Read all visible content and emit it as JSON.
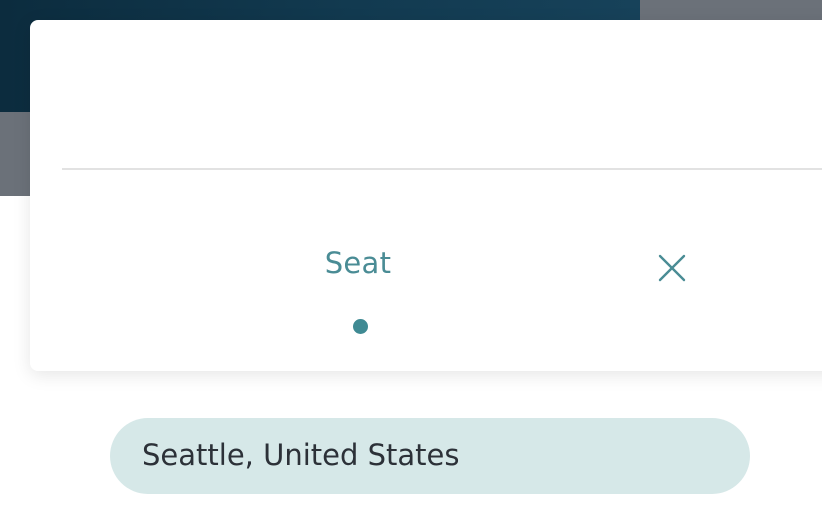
{
  "search": {
    "value": "",
    "placeholder": ""
  },
  "tabs": [
    {
      "label": "Seat",
      "active": true
    }
  ],
  "close": {
    "icon": "close-icon"
  },
  "location": {
    "label": "Seattle, United States"
  },
  "colors": {
    "accent": "#3f8a93",
    "tab_text": "#4a8c95",
    "chip_background": "#d6e8e8",
    "hero_dark": "#0f3347",
    "hero_gray": "#6b7179"
  }
}
